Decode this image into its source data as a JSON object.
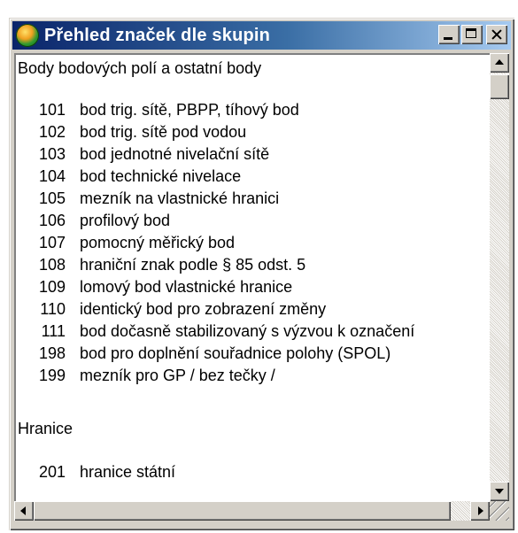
{
  "window": {
    "title": "Přehled značek dle skupin",
    "buttons": {
      "minimize": "minimize",
      "maximize": "maximize",
      "close": "close"
    }
  },
  "groups": [
    {
      "title": "Body bodových polí a ostatní body",
      "items": [
        {
          "code": "101",
          "desc": "bod trig. sítě, PBPP, tíhový bod"
        },
        {
          "code": "102",
          "desc": "bod trig. sítě pod vodou"
        },
        {
          "code": "103",
          "desc": "bod jednotné nivelační sítě"
        },
        {
          "code": "104",
          "desc": "bod technické nivelace"
        },
        {
          "code": "105",
          "desc": "mezník na vlastnické hranici"
        },
        {
          "code": "106",
          "desc": "profilový bod"
        },
        {
          "code": "107",
          "desc": "pomocný měřický bod"
        },
        {
          "code": "108",
          "desc": "hraniční znak podle § 85 odst. 5"
        },
        {
          "code": "109",
          "desc": "lomový bod vlastnické hranice"
        },
        {
          "code": "110",
          "desc": "identický bod pro zobrazení změny"
        },
        {
          "code": "111",
          "desc": "bod dočasně stabilizovaný s výzvou k označení"
        },
        {
          "code": "198",
          "desc": "bod pro doplnění souřadnice polohy (SPOL)"
        },
        {
          "code": "199",
          "desc": "mezník pro GP / bez tečky /"
        }
      ]
    },
    {
      "title": "Hranice",
      "items": [
        {
          "code": "201",
          "desc": "hranice státní"
        }
      ]
    }
  ],
  "icons": {
    "app": "app-globe-icon",
    "scroll_up": "arrow-up-icon",
    "scroll_down": "arrow-down-icon",
    "scroll_left": "arrow-left-icon",
    "scroll_right": "arrow-right-icon",
    "grip": "resize-grip-icon"
  }
}
